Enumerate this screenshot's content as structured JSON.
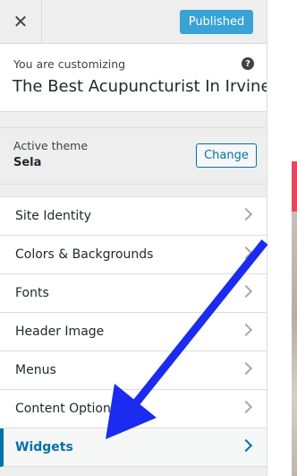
{
  "header": {
    "close_icon": "close-icon",
    "publish_label": "Published"
  },
  "info": {
    "label": "You are customizing",
    "site_title": "The Best Acupuncturist In Irvine",
    "help_icon": "question-circle-icon",
    "help_glyph": "?"
  },
  "theme": {
    "label": "Active theme",
    "name": "Sela",
    "change_label": "Change"
  },
  "sections": {
    "items": [
      {
        "label": "Site Identity"
      },
      {
        "label": "Colors & Backgrounds"
      },
      {
        "label": "Fonts"
      },
      {
        "label": "Header Image"
      },
      {
        "label": "Menus"
      },
      {
        "label": "Content Options"
      },
      {
        "label": "Widgets"
      }
    ],
    "active_index": 6
  },
  "colors": {
    "accent": "#0073aa",
    "publish_bg": "#38a3d4",
    "annotation_arrow": "#1b2bf0",
    "preview_accent": "#e2495d"
  },
  "annotation": {
    "type": "arrow",
    "points_to": "Widgets"
  }
}
